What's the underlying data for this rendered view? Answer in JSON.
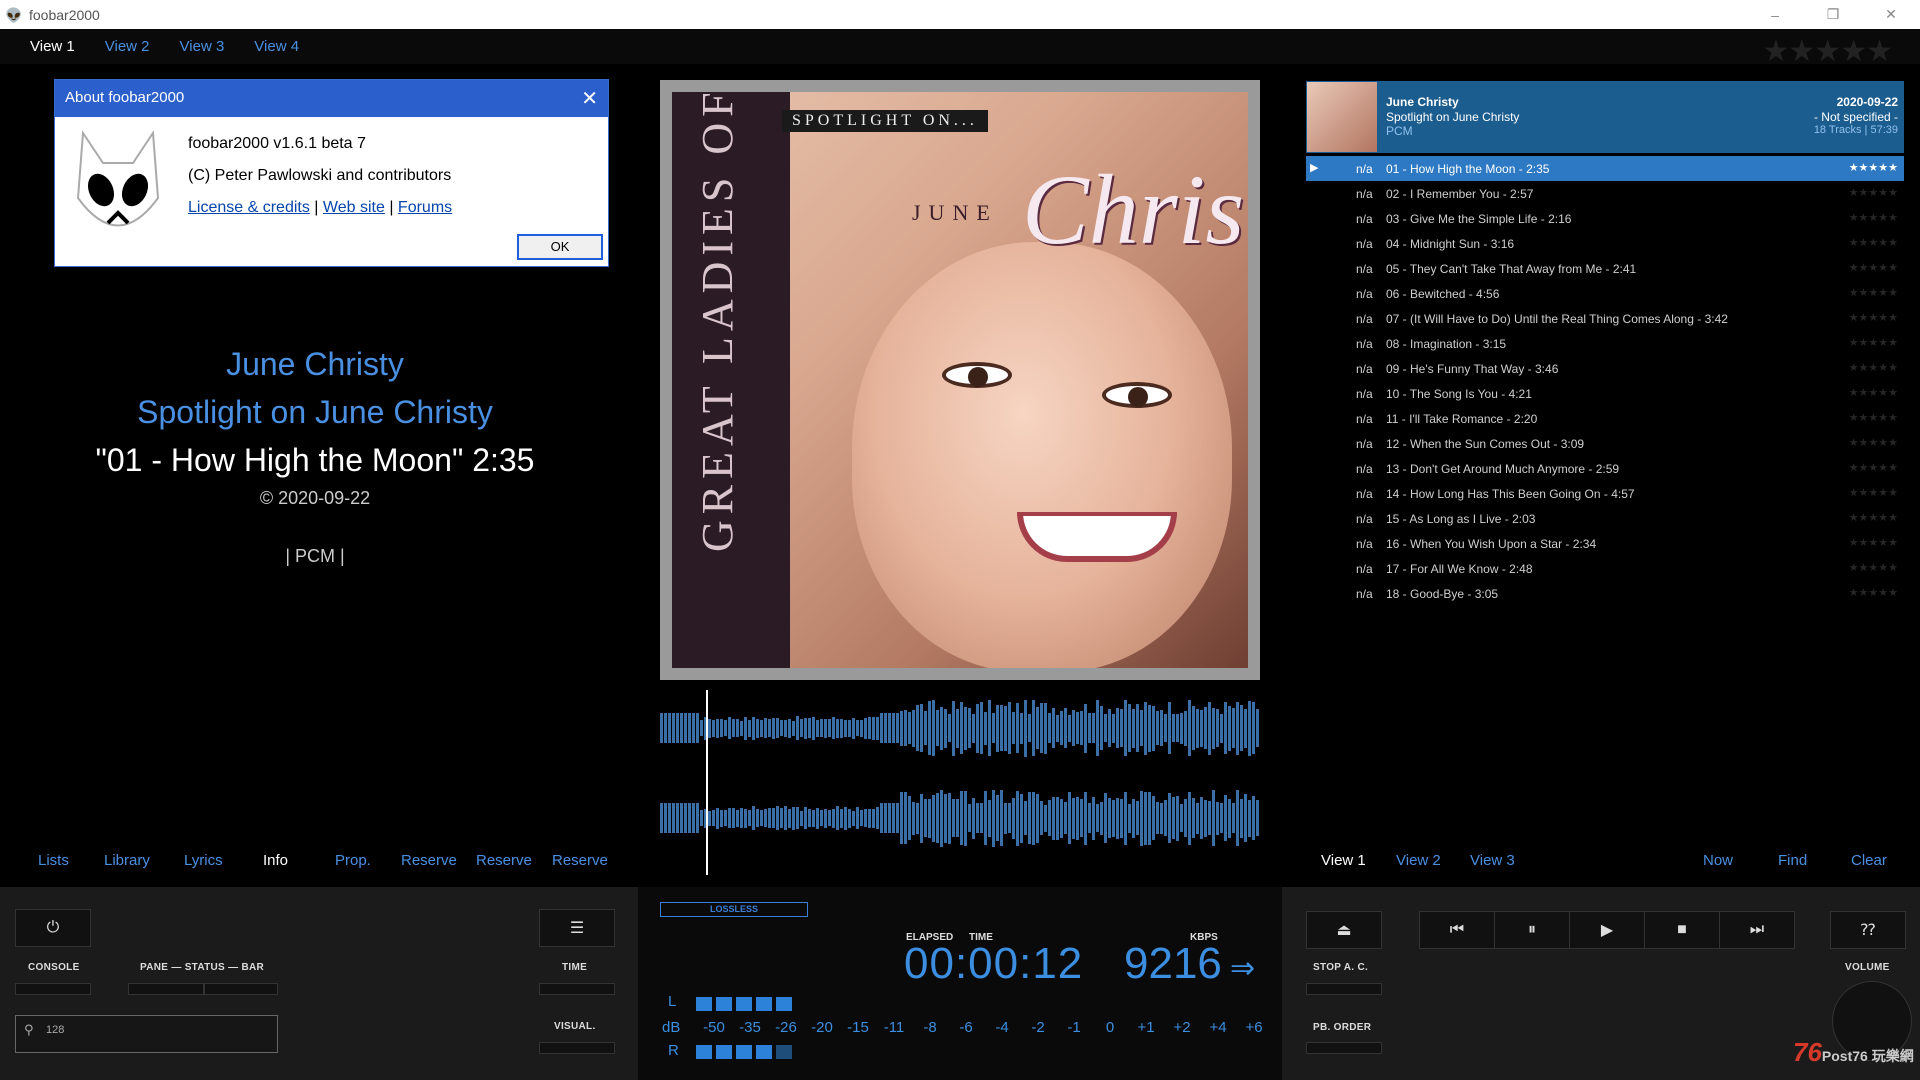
{
  "window": {
    "title": "foobar2000",
    "icon": "foobar-alien-icon",
    "minimize": "–",
    "restore": "❐",
    "close": "✕"
  },
  "top_tabs": [
    "View 1",
    "View 2",
    "View 3",
    "View 4"
  ],
  "top_rating": "★★★★★",
  "about": {
    "title": "About foobar2000",
    "close": "✕",
    "version": "foobar2000 v1.6.1 beta 7",
    "copyright": "(C) Peter Pawlowski and contributors",
    "link_license": "License & credits",
    "link_web": "Web site",
    "link_forums": "Forums",
    "sep": "|",
    "ok": "OK"
  },
  "track_info": {
    "artist": "June Christy",
    "album": "Spotlight on June Christy",
    "track": "\"01 - How High the Moon\" 2:35",
    "date": "© 2020-09-22",
    "codec": "| PCM |"
  },
  "album_art": {
    "spine": "GREAT LADIES OF SONG",
    "spotlight": "SPOTLIGHT ON...",
    "june": "JUNE",
    "christy": "Christy"
  },
  "left_tabs": [
    "Lists",
    "Library",
    "Lyrics",
    "Info",
    "Prop.",
    "Reserve",
    "Reserve",
    "Reserve"
  ],
  "right_tabs": [
    "View 1",
    "View 2",
    "View 3",
    "Now",
    "Find",
    "Clear"
  ],
  "playlist_header": {
    "artist": "June Christy",
    "album": "Spotlight on June Christy",
    "codec": "PCM",
    "date": "2020-09-22",
    "genre": "- Not specified -",
    "summary": "18 Tracks | 57:39"
  },
  "playlist": [
    {
      "na": "n/a",
      "title": "01 - How High the Moon - 2:35",
      "playing": true
    },
    {
      "na": "n/a",
      "title": "02 - I Remember You - 2:57"
    },
    {
      "na": "n/a",
      "title": "03 - Give Me the Simple Life - 2:16"
    },
    {
      "na": "n/a",
      "title": "04 - Midnight Sun - 3:16"
    },
    {
      "na": "n/a",
      "title": "05 - They Can't Take That Away from Me - 2:41"
    },
    {
      "na": "n/a",
      "title": "06 - Bewitched - 4:56"
    },
    {
      "na": "n/a",
      "title": "07 - (It Will Have to Do) Until the Real Thing Comes Along - 3:42"
    },
    {
      "na": "n/a",
      "title": "08 - Imagination - 3:15"
    },
    {
      "na": "n/a",
      "title": "09 - He's Funny That Way - 3:46"
    },
    {
      "na": "n/a",
      "title": "10 - The Song Is You - 4:21"
    },
    {
      "na": "n/a",
      "title": "11 - I'll Take Romance - 2:20"
    },
    {
      "na": "n/a",
      "title": "12 - When the Sun Comes Out - 3:09"
    },
    {
      "na": "n/a",
      "title": "13 - Don't Get Around Much Anymore - 2:59"
    },
    {
      "na": "n/a",
      "title": "14 - How Long Has This Been Going On - 4:57"
    },
    {
      "na": "n/a",
      "title": "15 - As Long as I Live - 2:03"
    },
    {
      "na": "n/a",
      "title": "16 - When You Wish Upon a Star - 2:34"
    },
    {
      "na": "n/a",
      "title": "17 - For All We Know - 2:48"
    },
    {
      "na": "n/a",
      "title": "18 - Good-Bye - 3:05"
    }
  ],
  "controls": {
    "console": "CONSOLE",
    "pane_status_bar": "PANE — STATUS — BAR",
    "time": "TIME",
    "visual": "VISUAL.",
    "search_value": "128",
    "lossless": "LOSSLESS",
    "elapsed": "ELAPSED",
    "time_cap": "TIME",
    "kbps": "KBPS",
    "elapsed_value": "00:00:12",
    "kbps_value": "9216",
    "meter_l": "L",
    "meter_r": "R",
    "meter_db": "dB",
    "db_scale": [
      "-50",
      "-35",
      "-26",
      "-20",
      "-15",
      "-11",
      "-8",
      "-6",
      "-4",
      "-2",
      "-1",
      "0",
      "+1",
      "+2",
      "+4",
      "+6"
    ],
    "stop_ac": "STOP A. C.",
    "pb_order": "PB. ORDER",
    "volume": "VOLUME",
    "help": "⁇"
  },
  "watermark": {
    "main": "76",
    "sub": "Post76 玩樂網"
  }
}
